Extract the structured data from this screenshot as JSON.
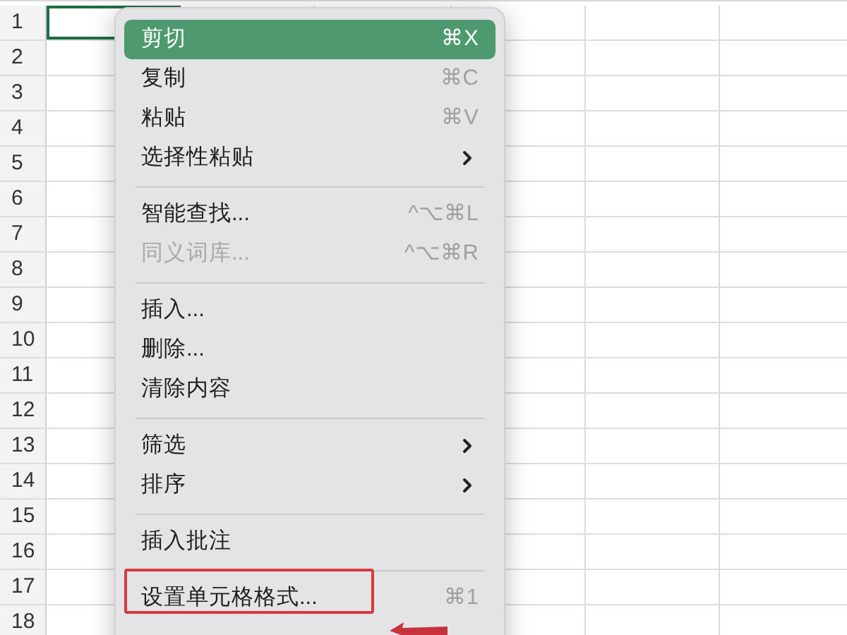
{
  "sheet": {
    "rows": [
      {
        "label": "1",
        "selected": true
      },
      {
        "label": "2",
        "selected": false
      },
      {
        "label": "3",
        "selected": false
      },
      {
        "label": "4",
        "selected": false
      },
      {
        "label": "5",
        "selected": false
      },
      {
        "label": "6",
        "selected": false
      },
      {
        "label": "7",
        "selected": false
      },
      {
        "label": "8",
        "selected": false
      },
      {
        "label": "9",
        "selected": false
      },
      {
        "label": "10",
        "selected": false
      },
      {
        "label": "11",
        "selected": false
      },
      {
        "label": "12",
        "selected": false
      },
      {
        "label": "13",
        "selected": false
      },
      {
        "label": "14",
        "selected": false
      },
      {
        "label": "15",
        "selected": false
      },
      {
        "label": "16",
        "selected": false
      },
      {
        "label": "17",
        "selected": false
      },
      {
        "label": "18",
        "selected": false
      }
    ]
  },
  "context_menu": {
    "items": [
      {
        "kind": "item",
        "label": "剪切",
        "shortcut": "⌘X",
        "selected": true,
        "disabled": false,
        "submenu": false,
        "annotated": false
      },
      {
        "kind": "item",
        "label": "复制",
        "shortcut": "⌘C",
        "selected": false,
        "disabled": false,
        "submenu": false,
        "annotated": false
      },
      {
        "kind": "item",
        "label": "粘贴",
        "shortcut": "⌘V",
        "selected": false,
        "disabled": false,
        "submenu": false,
        "annotated": false
      },
      {
        "kind": "item",
        "label": "选择性粘贴",
        "selected": false,
        "disabled": false,
        "submenu": true,
        "annotated": false
      },
      {
        "kind": "separator"
      },
      {
        "kind": "item",
        "label": "智能查找...",
        "shortcut": "^⌥⌘L",
        "selected": false,
        "disabled": false,
        "submenu": false,
        "annotated": false
      },
      {
        "kind": "item",
        "label": "同义词库...",
        "shortcut": "^⌥⌘R",
        "selected": false,
        "disabled": true,
        "submenu": false,
        "annotated": false
      },
      {
        "kind": "separator"
      },
      {
        "kind": "item",
        "label": "插入...",
        "selected": false,
        "disabled": false,
        "submenu": false,
        "annotated": false
      },
      {
        "kind": "item",
        "label": "删除...",
        "selected": false,
        "disabled": false,
        "submenu": false,
        "annotated": false
      },
      {
        "kind": "item",
        "label": "清除内容",
        "selected": false,
        "disabled": false,
        "submenu": false,
        "annotated": false
      },
      {
        "kind": "separator"
      },
      {
        "kind": "item",
        "label": "筛选",
        "selected": false,
        "disabled": false,
        "submenu": true,
        "annotated": false
      },
      {
        "kind": "item",
        "label": "排序",
        "selected": false,
        "disabled": false,
        "submenu": true,
        "annotated": false
      },
      {
        "kind": "separator"
      },
      {
        "kind": "item",
        "label": "插入批注",
        "selected": false,
        "disabled": false,
        "submenu": false,
        "annotated": false
      },
      {
        "kind": "separator"
      },
      {
        "kind": "item",
        "label": "设置单元格格式...",
        "shortcut": "⌘1",
        "selected": false,
        "disabled": false,
        "submenu": false,
        "annotated": true
      }
    ]
  }
}
